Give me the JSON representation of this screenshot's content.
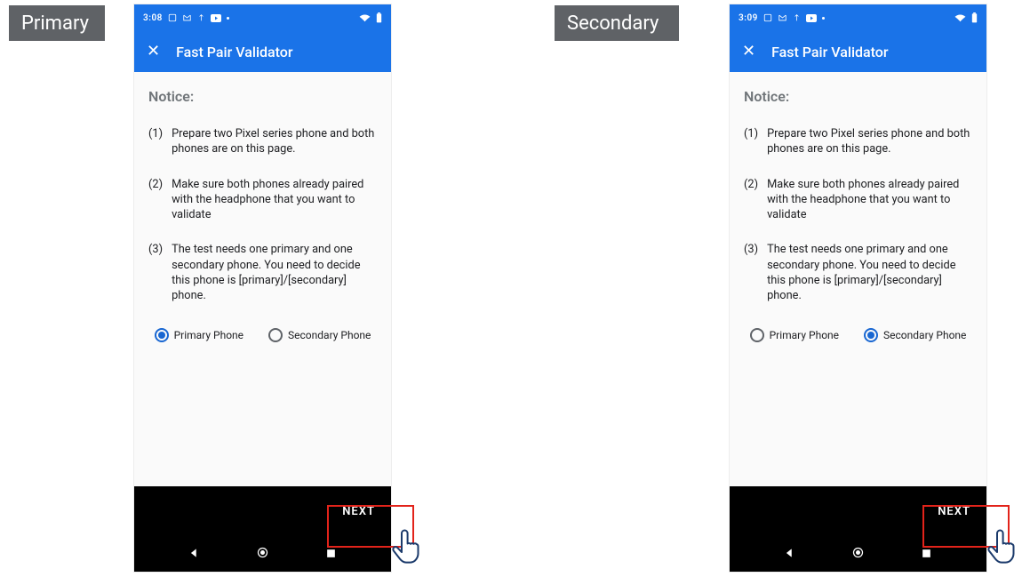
{
  "labels": {
    "primary": "Primary",
    "secondary": "Secondary"
  },
  "phones": [
    {
      "id": "primary",
      "status": {
        "time": "3:08"
      },
      "app_title": "Fast Pair Validator",
      "notice_heading": "Notice:",
      "notice_items": [
        "Prepare two Pixel series phone and both phones are on this page.",
        "Make sure both phones already paired with the headphone that you want to validate",
        "The test needs one primary and one secondary phone. You need to decide this phone is [primary]/[secondary] phone."
      ],
      "radio": {
        "primary_label": "Primary Phone",
        "secondary_label": "Secondary Phone",
        "selected": "primary"
      },
      "next_label": "NEXT"
    },
    {
      "id": "secondary",
      "status": {
        "time": "3:09"
      },
      "app_title": "Fast Pair Validator",
      "notice_heading": "Notice:",
      "notice_items": [
        "Prepare two Pixel series phone and both phones are on this page.",
        "Make sure both phones already paired with the headphone that you want to validate",
        "The test needs one primary and one secondary phone. You need to decide this phone is [primary]/[secondary] phone."
      ],
      "radio": {
        "primary_label": "Primary Phone",
        "secondary_label": "Secondary Phone",
        "selected": "secondary"
      },
      "next_label": "NEXT"
    }
  ],
  "colors": {
    "accent": "#1a73e8",
    "highlight": "#e2231a"
  }
}
